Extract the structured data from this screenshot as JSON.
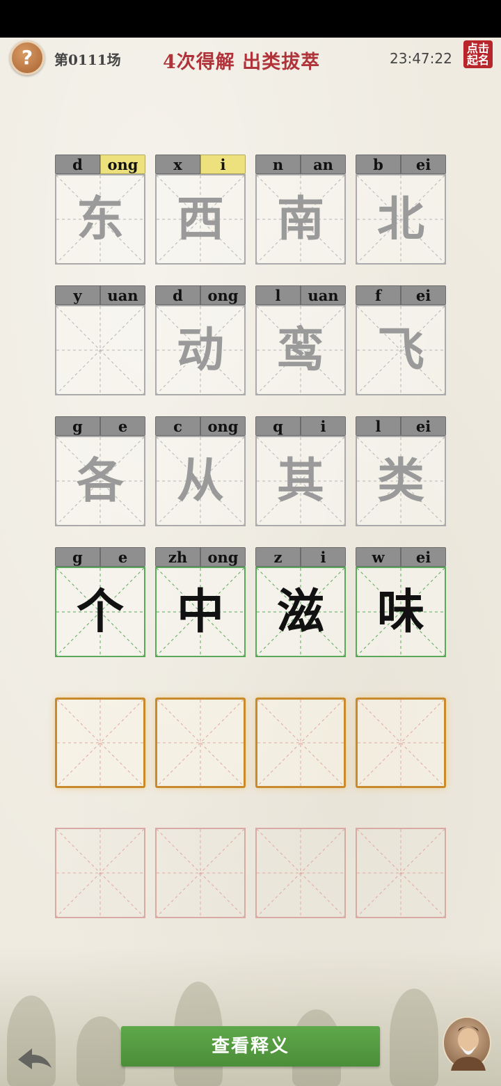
{
  "header": {
    "help_icon": "?",
    "round_label": "第0111场",
    "solve_text": "4次得解  出类拔萃",
    "clock": "23:47:22",
    "ranking_seal": "点击\n起名"
  },
  "colors": {
    "gray": "#8f8f8f",
    "yellow": "#ece17c",
    "green": "#6cc36c",
    "title_red": "#b0333a",
    "button_green": "#56a043",
    "active_slot": "#c98a2c"
  },
  "grid": {
    "rows": [
      {
        "cells": [
          {
            "initial": "d",
            "final": "ong",
            "initial_state": "gray",
            "final_state": "yellow",
            "char": "东"
          },
          {
            "initial": "x",
            "final": "i",
            "initial_state": "gray",
            "final_state": "yellow",
            "char": "西"
          },
          {
            "initial": "n",
            "final": "an",
            "initial_state": "gray",
            "final_state": "gray",
            "char": "南"
          },
          {
            "initial": "b",
            "final": "ei",
            "initial_state": "gray",
            "final_state": "green",
            "char": "北"
          }
        ]
      },
      {
        "cells": [
          {
            "initial": "y",
            "final": "uan",
            "initial_state": "gray",
            "final_state": "gray",
            "char": ""
          },
          {
            "initial": "d",
            "final": "ong",
            "initial_state": "gray",
            "final_state": "green",
            "char": "动"
          },
          {
            "initial": "l",
            "final": "uan",
            "initial_state": "gray",
            "final_state": "gray",
            "char": "鸾"
          },
          {
            "initial": "f",
            "final": "ei",
            "initial_state": "gray",
            "final_state": "green",
            "char": "飞"
          }
        ]
      },
      {
        "cells": [
          {
            "initial": "g",
            "final": "e",
            "initial_state": "green",
            "final_state": "green",
            "char": "各"
          },
          {
            "initial": "c",
            "final": "ong",
            "initial_state": "gray",
            "final_state": "green",
            "char": "从"
          },
          {
            "initial": "q",
            "final": "i",
            "initial_state": "gray",
            "final_state": "green",
            "char": "其"
          },
          {
            "initial": "l",
            "final": "ei",
            "initial_state": "gray",
            "final_state": "green",
            "char": "类"
          }
        ]
      },
      {
        "solved": true,
        "cells": [
          {
            "initial": "g",
            "final": "e",
            "initial_state": "green",
            "final_state": "green",
            "char": "个"
          },
          {
            "initial": "zh",
            "final": "ong",
            "initial_state": "green",
            "final_state": "green",
            "char": "中"
          },
          {
            "initial": "z",
            "final": "i",
            "initial_state": "green",
            "final_state": "green",
            "char": "滋"
          },
          {
            "initial": "w",
            "final": "ei",
            "initial_state": "green",
            "final_state": "green",
            "char": "味"
          }
        ]
      }
    ],
    "active_input_row_count": 4,
    "empty_input_row_count": 4
  },
  "footer": {
    "meaning_button": "查看释义",
    "back_icon": "back-arrow-icon",
    "avatar_icon": "sage-avatar-icon"
  }
}
